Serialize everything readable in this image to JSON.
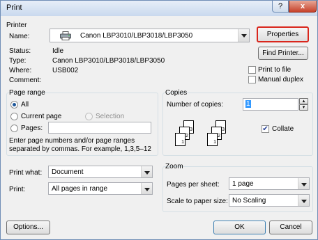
{
  "window": {
    "title": "Print",
    "help_glyph": "?",
    "close_glyph": "x"
  },
  "printer": {
    "group_label": "Printer",
    "name_label": "Name:",
    "name_value": "Canon LBP3010/LBP3018/LBP3050",
    "properties_button": "Properties",
    "find_printer_button": "Find Printer...",
    "status_label": "Status:",
    "status_value": "Idle",
    "type_label": "Type:",
    "type_value": "Canon LBP3010/LBP3018/LBP3050",
    "where_label": "Where:",
    "where_value": "USB002",
    "comment_label": "Comment:",
    "comment_value": "",
    "print_to_file_label": "Print to file",
    "manual_duplex_label": "Manual duplex",
    "print_to_file_checked": false,
    "manual_duplex_checked": false
  },
  "page_range": {
    "group_label": "Page range",
    "all_label": "All",
    "current_page_label": "Current page",
    "selection_label": "Selection",
    "pages_label": "Pages:",
    "pages_value": "",
    "selected": "All",
    "hint": "Enter page numbers and/or page ranges separated by commas.  For example, 1,3,5–12"
  },
  "copies": {
    "group_label": "Copies",
    "number_label": "Number of copies:",
    "number_value": "1",
    "collate_label": "Collate",
    "collate_checked": true,
    "page_numbers": [
      "1",
      "2",
      "3"
    ]
  },
  "print_what": {
    "label": "Print what:",
    "value": "Document"
  },
  "print": {
    "label": "Print:",
    "value": "All pages in range"
  },
  "zoom": {
    "group_label": "Zoom",
    "pages_per_sheet_label": "Pages per sheet:",
    "pages_per_sheet_value": "1 page",
    "scale_label": "Scale to paper size:",
    "scale_value": "No Scaling"
  },
  "footer": {
    "options_button": "Options...",
    "ok_button": "OK",
    "cancel_button": "Cancel"
  },
  "colors": {
    "accent_highlight": "#d9261c",
    "selection_blue": "#3399ff"
  },
  "icons": {
    "printer": "printer-icon",
    "check": "✔",
    "spin_up": "▴",
    "spin_down": "▾"
  }
}
